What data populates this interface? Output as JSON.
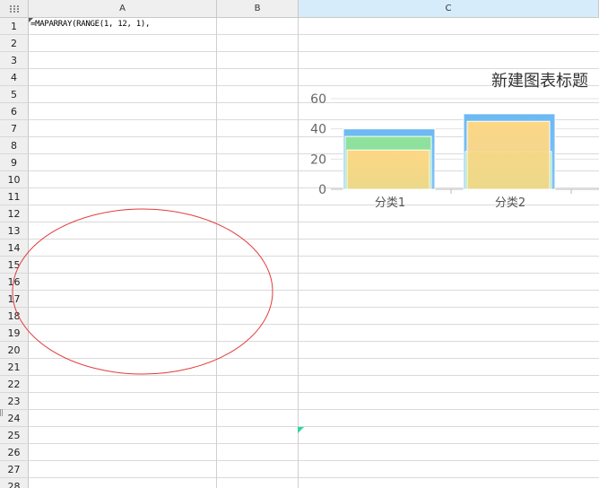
{
  "columns": [
    "A",
    "B",
    "C"
  ],
  "selected_column": "C",
  "rows": [
    "1",
    "2",
    "3",
    "4",
    "5",
    "6",
    "7",
    "8",
    "9",
    "10",
    "11",
    "12",
    "13",
    "14",
    "15",
    "16",
    "17",
    "18",
    "19",
    "20",
    "21",
    "22",
    "23",
    "24",
    "25",
    "26",
    "27",
    "28"
  ],
  "cells": {
    "A1": "=MAPARRAY(RANGE(1, 12, 1),"
  },
  "chart": {
    "title": "新建图表标题",
    "chart_data": {
      "type": "bar",
      "title": "新建图表标题",
      "categories": [
        "分类1",
        "分类2"
      ],
      "series": [
        {
          "values": [
            40,
            50
          ],
          "color": "#6cb9f3"
        },
        {
          "values": [
            35,
            25
          ],
          "color": "#8fe29a"
        },
        {
          "values": [
            26,
            45
          ],
          "color": "#fdd785"
        }
      ],
      "y_ticks": [
        "0",
        "20",
        "40",
        "60"
      ],
      "ylim": [
        0,
        60
      ],
      "grid": true
    }
  },
  "shapes": {
    "ellipse_color": "#e23b3b"
  },
  "colors": {
    "header_bg": "#efefef",
    "selected_header_bg": "#d7ecfb",
    "grid_line": "#dadada",
    "fill_handle": "#2bd6a3"
  }
}
